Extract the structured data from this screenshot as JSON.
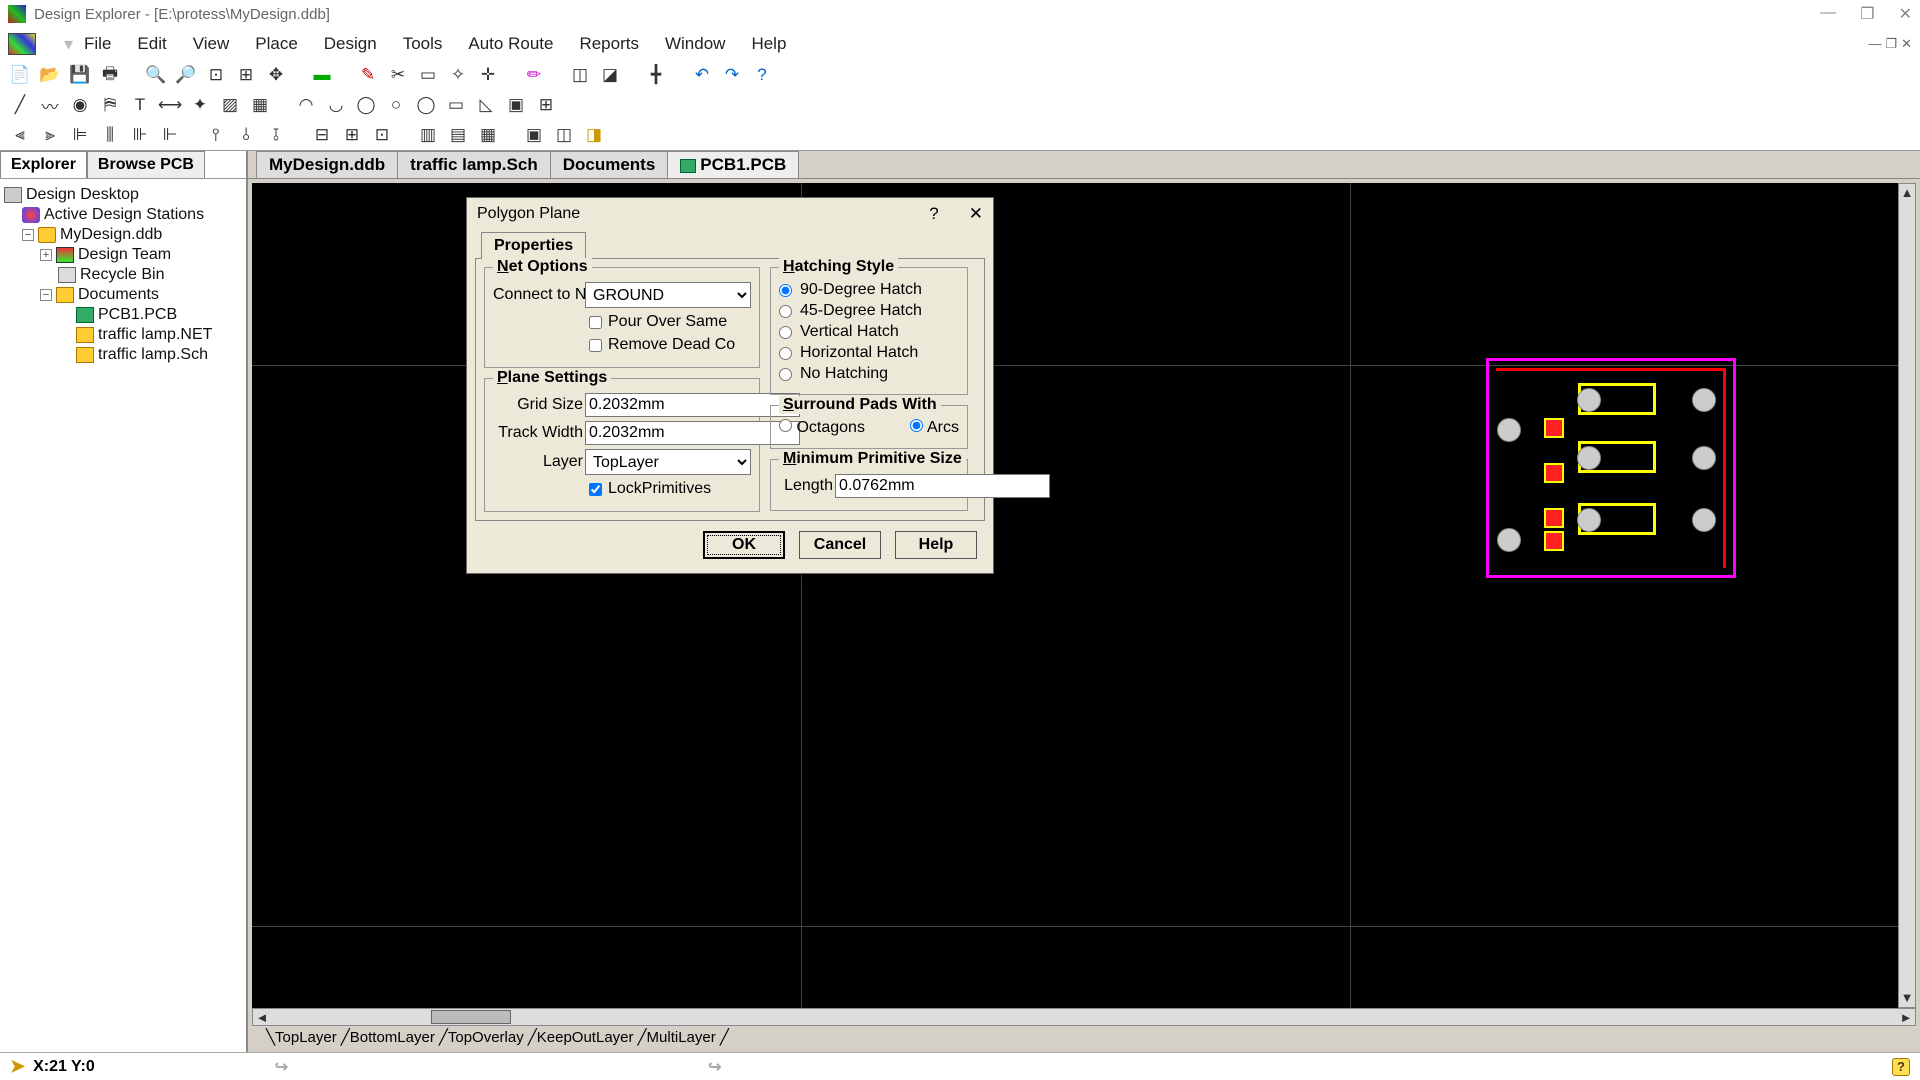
{
  "window": {
    "title": "Design Explorer - [E:\\protess\\MyDesign.ddb]"
  },
  "menu": [
    "File",
    "Edit",
    "View",
    "Place",
    "Design",
    "Tools",
    "Auto Route",
    "Reports",
    "Window",
    "Help"
  ],
  "sidebar": {
    "tabs": [
      "Explorer",
      "Browse PCB"
    ],
    "tree": {
      "root": "Design Desktop",
      "stations": "Active Design Stations",
      "db": "MyDesign.ddb",
      "team": "Design Team",
      "bin": "Recycle Bin",
      "docs": "Documents",
      "files": [
        "PCB1.PCB",
        "traffic lamp.NET",
        "traffic lamp.Sch"
      ]
    }
  },
  "docTabs": [
    "MyDesign.ddb",
    "traffic lamp.Sch",
    "Documents",
    "PCB1.PCB"
  ],
  "layerTabs": [
    "TopLayer",
    "BottomLayer",
    "TopOverlay",
    "KeepOutLayer",
    "MultiLayer"
  ],
  "dialog": {
    "title": "Polygon Plane",
    "tab": "Properties",
    "netOptions": {
      "legend": "Net Options",
      "connectLabel": "Connect to N",
      "connectValue": "GROUND",
      "pourOver": "Pour Over Same",
      "removeDead": "Remove Dead Co"
    },
    "planeSettings": {
      "legend": "Plane Settings",
      "gridLabel": "Grid Size",
      "gridValue": "0.2032mm",
      "trackLabel": "Track Width",
      "trackValue": "0.2032mm",
      "layerLabel": "Layer",
      "layerValue": "TopLayer",
      "lockPrim": "LockPrimitives"
    },
    "hatching": {
      "legend": "Hatching Style",
      "options": [
        "90-Degree Hatch",
        "45-Degree Hatch",
        "Vertical Hatch",
        "Horizontal Hatch",
        "No Hatching"
      ]
    },
    "surround": {
      "legend": "Surround Pads With",
      "octagons": "Octagons",
      "arcs": "Arcs"
    },
    "minPrim": {
      "legend": "Minimum Primitive Size",
      "lengthLabel": "Length",
      "lengthValue": "0.0762mm"
    },
    "buttons": {
      "ok": "OK",
      "cancel": "Cancel",
      "help": "Help"
    }
  },
  "status": {
    "coords": "X:21 Y:0"
  }
}
